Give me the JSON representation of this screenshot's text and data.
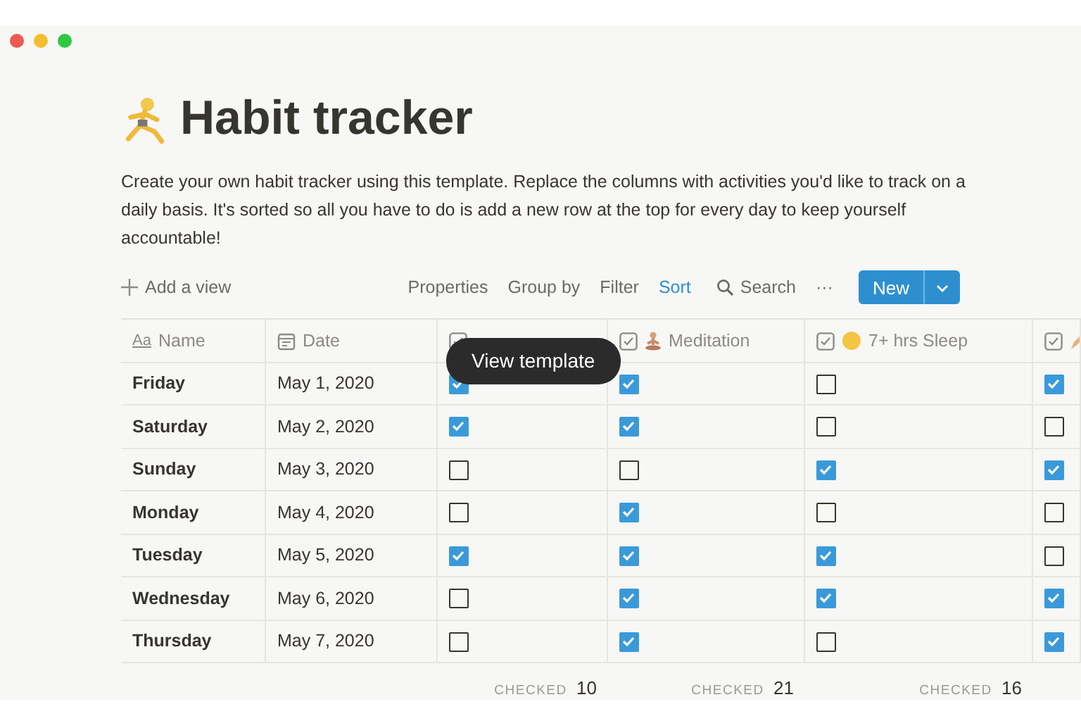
{
  "title": "Habit tracker",
  "description": "Create your own habit tracker using this template. Replace the columns with activities you'd like to track on a daily basis. It's sorted so all you have to do is add a new row at the top for every day to keep yourself accountable!",
  "toolbar": {
    "add_view": "Add a view",
    "actions": [
      {
        "label": "Properties",
        "selected": false
      },
      {
        "label": "Group by",
        "selected": false
      },
      {
        "label": "Filter",
        "selected": false
      },
      {
        "label": "Sort",
        "selected": true
      }
    ],
    "search": "Search",
    "more": "···",
    "new_button": "New"
  },
  "columns": [
    {
      "kind": "title",
      "icon_text": "Aa",
      "label": "Name"
    },
    {
      "kind": "date",
      "label": "Date"
    },
    {
      "kind": "checkbox"
    },
    {
      "kind": "checkbox",
      "label": "Meditation"
    },
    {
      "kind": "checkbox",
      "label": "7+ hrs Sleep"
    },
    {
      "kind": "checkbox"
    }
  ],
  "rows": [
    {
      "name": "Friday",
      "date": "May 1, 2020",
      "checks": [
        true,
        true,
        false,
        true
      ]
    },
    {
      "name": "Saturday",
      "date": "May 2, 2020",
      "checks": [
        true,
        true,
        false,
        false
      ]
    },
    {
      "name": "Sunday",
      "date": "May 3, 2020",
      "checks": [
        false,
        false,
        true,
        true
      ]
    },
    {
      "name": "Monday",
      "date": "May 4, 2020",
      "checks": [
        false,
        true,
        false,
        false
      ]
    },
    {
      "name": "Tuesday",
      "date": "May 5, 2020",
      "checks": [
        true,
        true,
        true,
        false
      ]
    },
    {
      "name": "Wednesday",
      "date": "May 6, 2020",
      "checks": [
        false,
        true,
        true,
        true
      ]
    },
    {
      "name": "Thursday",
      "date": "May 7, 2020",
      "checks": [
        false,
        true,
        false,
        true
      ]
    }
  ],
  "footer": [
    {
      "label": "CHECKED",
      "value": "10"
    },
    {
      "label": "CHECKED",
      "value": "21"
    },
    {
      "label": "CHECKED",
      "value": "16"
    }
  ],
  "tooltip": "View template"
}
